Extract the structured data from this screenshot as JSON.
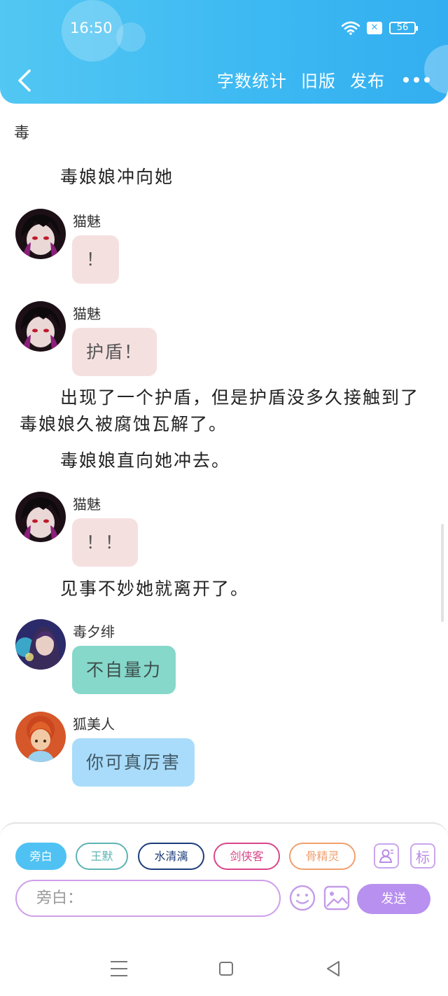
{
  "status_bar": {
    "time": "16:50",
    "battery": "56"
  },
  "header": {
    "actions": [
      {
        "label": "字数统计"
      },
      {
        "label": "旧版"
      },
      {
        "label": "发布"
      }
    ]
  },
  "content": {
    "chapter_title": "毒",
    "narration_1": "毒娘娘冲向她",
    "msg_1": {
      "name": "猫魅",
      "text": "！"
    },
    "msg_2": {
      "name": "猫魅",
      "text": "护盾！"
    },
    "narration_2": "出现了一个护盾，但是护盾没多久接触到了毒娘娘久被腐蚀瓦解了。",
    "narration_3": "毒娘娘直向她冲去。",
    "msg_3": {
      "name": "猫魅",
      "text": "！！"
    },
    "narration_4": "见事不妙她就离开了。",
    "msg_4": {
      "name": "毒夕绯",
      "text": "不自量力"
    },
    "msg_5": {
      "name": "狐美人",
      "text": "你可真厉害"
    }
  },
  "panel": {
    "characters": [
      {
        "label": "旁白",
        "color": "#4fc2f3",
        "active": true
      },
      {
        "label": "王默",
        "color": "#5fb3b3",
        "active": false
      },
      {
        "label": "水清漓",
        "color": "#1d3c7a",
        "active": false
      },
      {
        "label": "剑侠客",
        "color": "#d8478a",
        "active": false
      },
      {
        "label": "骨精灵",
        "color": "#f0a070",
        "active": false
      }
    ],
    "tag_button": "标",
    "input_placeholder": "旁白：",
    "send_label": "发送"
  }
}
